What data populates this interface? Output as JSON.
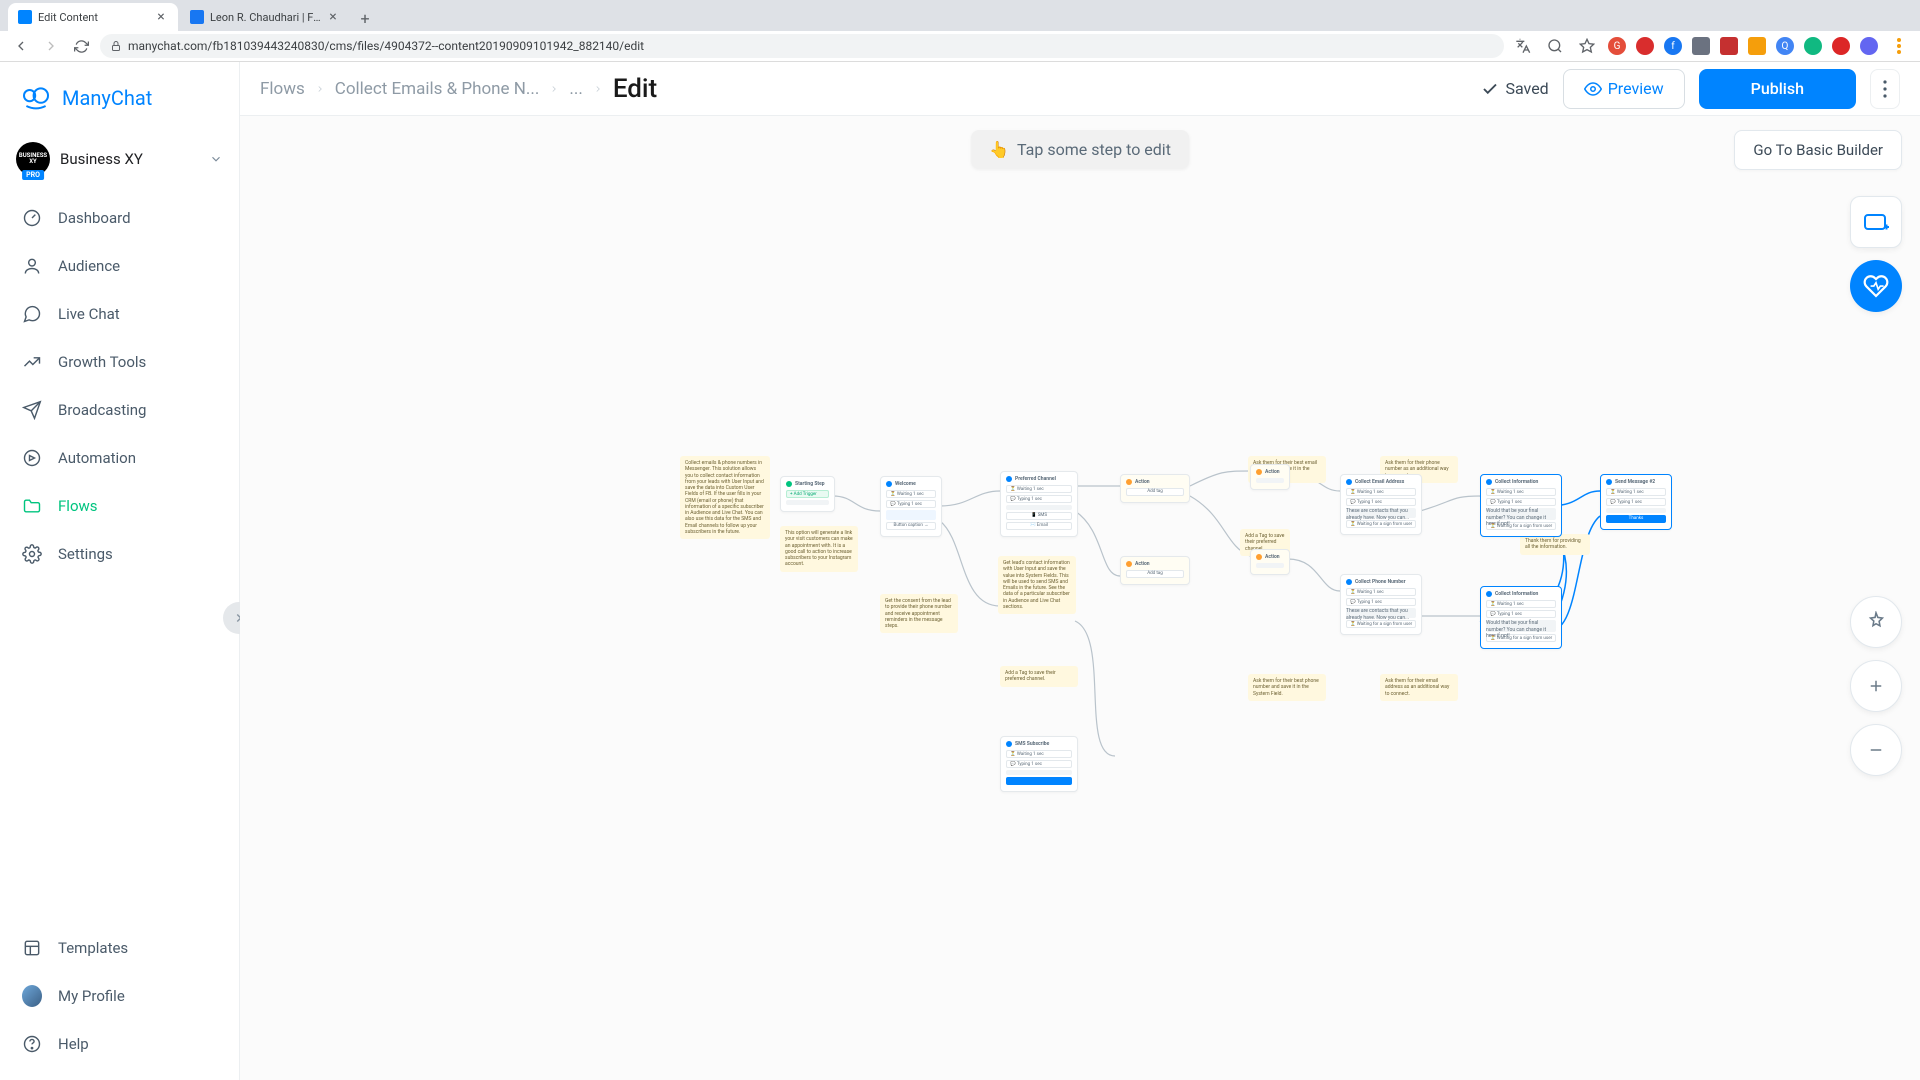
{
  "browser": {
    "tabs": [
      {
        "title": "Edit Content",
        "favicon": "#0084ff"
      },
      {
        "title": "Leon R. Chaudhari | Facebook",
        "favicon": "#1877f2"
      }
    ],
    "url": "manychat.com/fb181039443240830/cms/files/4904372--content20190909101942_882140/edit"
  },
  "sidebar": {
    "brand": "ManyChat",
    "workspace": {
      "name": "Business XY",
      "badge": "PRO",
      "avatar": "BUSINESS XY"
    },
    "items": {
      "dashboard": "Dashboard",
      "audience": "Audience",
      "livechat": "Live Chat",
      "growth": "Growth Tools",
      "broadcasting": "Broadcasting",
      "automation": "Automation",
      "flows": "Flows",
      "settings": "Settings",
      "templates": "Templates",
      "profile": "My Profile",
      "help": "Help"
    }
  },
  "header": {
    "crumbs": {
      "root": "Flows",
      "flow": "Collect Emails & Phone N...",
      "dots": "...",
      "current": "Edit"
    },
    "saved": "Saved",
    "preview": "Preview",
    "publish": "Publish"
  },
  "canvas": {
    "hint_emoji": "👆",
    "hint": "Tap some step to edit",
    "basic_builder": "Go To Basic Builder"
  },
  "notes": {
    "n1": "Collect emails & phone numbers in Messenger.\n\nThis solution allows you to collect contact information from your leads with User Input and save the data into Custom User Fields of FB. If the user fills in your CRM (email or phone) that information of a specific subscriber in Audience and Live Chat.\n\nYou can also use this data for the SMS and Email channels to follow up your subscribers in the future.",
    "n2": "This option will generate a link your visit customers can make an appointment with. It is a good call to action to increase subscribers to your Instagram account.",
    "n3": "Get lead's contact information with User Input and save the value into System Fields. This will be used to send SMS and Emails in the future. See the data of a particular subscriber in Audience and Live Chat sections.",
    "n4": "Add a Tag to save their preferred channel.",
    "n5": "Add a Tag to save their preferred channel.",
    "n6": "Get the consent from the lead to provide their phone number and receive appointment reminders in the message steps.",
    "n7": "Ask them for their best email address and save it in the System Field.",
    "n8": "Ask them for their best phone number and save it in the System Field.",
    "n9": "Ask them for their phone number as an additional way to connect.",
    "n10": "Ask them for their email address as an additional way to connect.",
    "n11": "Thank them for providing all the information."
  },
  "flownodes": {
    "start": "Starting Step",
    "add_trigger": "+ Add Trigger",
    "welcome": "Welcome",
    "preferred": "Preferred Channel",
    "sms_subscribe": "SMS Subscribe",
    "collect_email": "Collect Email Address",
    "collect_phone": "Collect Phone Number",
    "collect_info": "Collect Information",
    "send_msg2": "Send Message #2",
    "thanks": "Thanks",
    "typing": "Typing 1 sec",
    "waiting": "Waiting 1 sec",
    "sms_btn": "📱 SMS",
    "email_btn": "✉️ Email",
    "text_bubble": "These are contacts that you already have. Now you can...",
    "waiting_sign": "⏳ Waiting for a sign from user",
    "confirm_q": "Would that be your final number? You can change it here if not!",
    "add_tag": "Add tag"
  }
}
